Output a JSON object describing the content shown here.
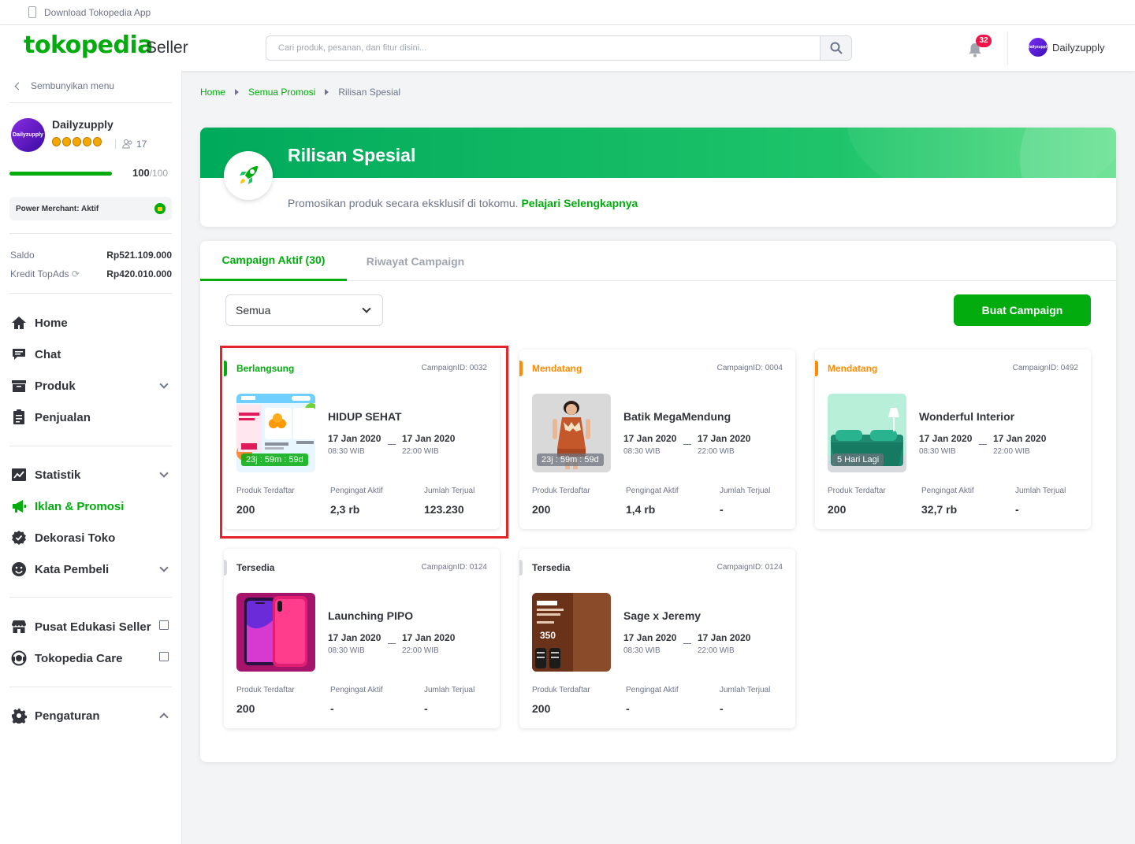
{
  "topbar": {
    "download_app": "Download Tokopedia App"
  },
  "header": {
    "logo": "tokopedia",
    "logo_suffix": "Seller",
    "search_placeholder": "Cari produk, pesanan, dan fitur disini...",
    "notification_count": "32",
    "user_name": "Dailyzupply",
    "avatar_text": "Dailyzupply"
  },
  "sidebar": {
    "hide_menu": "Sembunyikan menu",
    "shop_name": "Dailyzupply",
    "avatar_text": "Dailyzupply",
    "followers": "17",
    "score": "100",
    "score_max": "/100",
    "score_progress": 1.0,
    "power_merchant": "Power Merchant: Aktif",
    "saldo_label": "Saldo",
    "saldo_value": "Rp521.109.000",
    "topads_label": "Kredit TopAds",
    "topads_value": "Rp420.010.000",
    "nav": {
      "home": "Home",
      "chat": "Chat",
      "produk": "Produk",
      "penjualan": "Penjualan",
      "statistik": "Statistik",
      "iklan": "Iklan & Promosi",
      "dekorasi": "Dekorasi Toko",
      "kata_pembeli": "Kata Pembeli",
      "edukasi": "Pusat Edukasi Seller",
      "care": "Tokopedia Care",
      "pengaturan": "Pengaturan"
    }
  },
  "breadcrumb": {
    "home": "Home",
    "semua": "Semua Promosi",
    "current": "Rilisan Spesial"
  },
  "hero": {
    "title": "Rilisan Spesial",
    "desc": "Promosikan produk secara eksklusif di tokomu.",
    "link": "Pelajari Selengkapnya"
  },
  "tabs": {
    "active": "Campaign Aktif (30)",
    "history": "Riwayat Campaign"
  },
  "filter": {
    "selected": "Semua"
  },
  "create_button": "Buat Campaign",
  "stat_labels": {
    "produk": "Produk Terdaftar",
    "pengingat": "Pengingat Aktif",
    "terjual": "Jumlah Terjual"
  },
  "colors": {
    "primary": "#03ac0e",
    "orange": "#ff8c00",
    "grey": "#d6dadf",
    "highlight": "#e3242b"
  },
  "cards": [
    {
      "status": "Berlangsung",
      "campaign_id": "CampaignID: 0032",
      "name": "HIDUP SEHAT",
      "timer": "23j : 59m : 59d",
      "start_date": "17 Jan 2020",
      "start_time": "08:30 WIB",
      "end_date": "17 Jan 2020",
      "end_time": "22:00 WIB",
      "produk": "200",
      "pengingat": "2,3 rb",
      "terjual": "123.230"
    },
    {
      "status": "Mendatang",
      "campaign_id": "CampaignID: 0004",
      "name": "Batik MegaMendung",
      "timer": "23j : 59m : 59d",
      "start_date": "17 Jan 2020",
      "start_time": "08:30 WIB",
      "end_date": "17 Jan 2020",
      "end_time": "22:00 WIB",
      "produk": "200",
      "pengingat": "1,4 rb",
      "terjual": "-"
    },
    {
      "status": "Mendatang",
      "campaign_id": "CampaignID: 0492",
      "name": "Wonderful Interior",
      "timer": "5 Hari Lagi",
      "start_date": "17 Jan 2020",
      "start_time": "08:30 WIB",
      "end_date": "17 Jan 2020",
      "end_time": "22:00 WIB",
      "produk": "200",
      "pengingat": "32,7 rb",
      "terjual": "-"
    },
    {
      "status": "Tersedia",
      "campaign_id": "CampaignID: 0124",
      "name": "Launching PIPO",
      "start_date": "17 Jan 2020",
      "start_time": "08:30 WIB",
      "end_date": "17 Jan 2020",
      "end_time": "22:00 WIB",
      "produk": "200",
      "pengingat": "-",
      "terjual": "-"
    },
    {
      "status": "Tersedia",
      "campaign_id": "CampaignID: 0124",
      "name": "Sage x Jeremy",
      "start_date": "17 Jan 2020",
      "start_time": "08:30 WIB",
      "end_date": "17 Jan 2020",
      "end_time": "22:00 WIB",
      "produk": "200",
      "pengingat": "-",
      "terjual": "-"
    }
  ]
}
